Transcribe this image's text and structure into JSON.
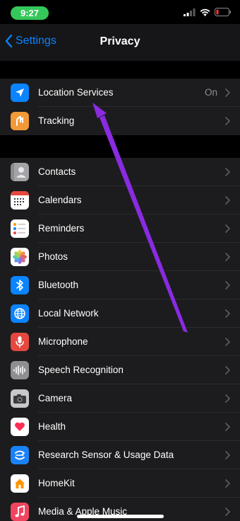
{
  "status_bar": {
    "time": "9:27"
  },
  "nav": {
    "back_label": "Settings",
    "title": "Privacy"
  },
  "groups": {
    "top": [
      {
        "label": "Location Services",
        "value": "On",
        "icon": "location-arrow-icon",
        "color": "#0a84ff"
      },
      {
        "label": "Tracking",
        "icon": "tracking-icon",
        "color": "#f29a38"
      }
    ],
    "apps": [
      {
        "label": "Contacts",
        "icon": "contacts-icon",
        "color": "#a3a3a8"
      },
      {
        "label": "Calendars",
        "icon": "calendars-icon",
        "color": "#ffffff"
      },
      {
        "label": "Reminders",
        "icon": "reminders-icon",
        "color": "#ffffff"
      },
      {
        "label": "Photos",
        "icon": "photos-icon",
        "color": "#ffffff"
      },
      {
        "label": "Bluetooth",
        "icon": "bluetooth-icon",
        "color": "#0a84ff"
      },
      {
        "label": "Local Network",
        "icon": "globe-icon",
        "color": "#0a84ff"
      },
      {
        "label": "Microphone",
        "icon": "microphone-icon",
        "color": "#e5483e"
      },
      {
        "label": "Speech Recognition",
        "icon": "waveform-icon",
        "color": "#8e8e93"
      },
      {
        "label": "Camera",
        "icon": "camera-icon",
        "color": "#8e8e93"
      },
      {
        "label": "Health",
        "icon": "heart-icon",
        "color": "#ffffff"
      },
      {
        "label": "Research Sensor & Usage Data",
        "icon": "research-icon",
        "color": "#1a82f7"
      },
      {
        "label": "HomeKit",
        "icon": "home-icon",
        "color": "#ffffff"
      },
      {
        "label": "Media & Apple Music",
        "icon": "music-note-icon",
        "color": "#f0455f"
      }
    ]
  },
  "colors": {
    "accent": "#0a84ff",
    "annotation": "#8a2be2",
    "battery_low": "#ff3b30"
  }
}
